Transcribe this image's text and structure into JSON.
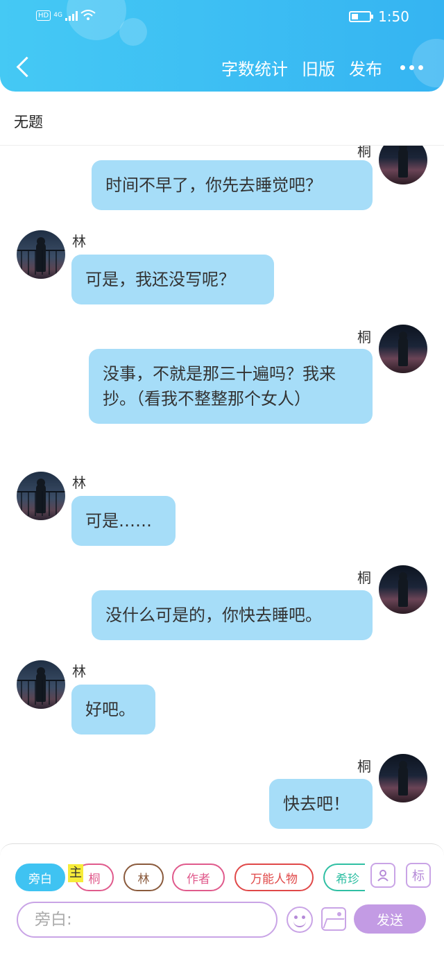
{
  "status_bar": {
    "network": "HD",
    "signal_label": "4G",
    "time": "1:50"
  },
  "header": {
    "actions": [
      "字数统计",
      "旧版",
      "发布"
    ]
  },
  "title": "无题",
  "messages": [
    {
      "side": "right",
      "name": "桐",
      "text": "时间不早了，你先去睡觉吧？"
    },
    {
      "side": "left",
      "name": "林",
      "text": "可是，我还没写呢？"
    },
    {
      "side": "right",
      "name": "桐",
      "text": "没事，不就是那三十遍吗？我来抄。（看我不整整那个女人）"
    },
    {
      "side": "left",
      "name": "林",
      "text": "可是……"
    },
    {
      "side": "right",
      "name": "桐",
      "text": "没什么可是的，你快去睡吧。"
    },
    {
      "side": "left",
      "name": "林",
      "text": "好吧。"
    },
    {
      "side": "right",
      "name": "桐",
      "text": "快去吧！"
    }
  ],
  "toolbar": {
    "roles": [
      "旁白",
      "桐",
      "林",
      "作者",
      "万能人物",
      "希珍"
    ],
    "active_role": "旁白",
    "main_tag": "主",
    "role_icon_label": "标",
    "input_placeholder": "旁白:",
    "send_label": "发送"
  },
  "icons": [
    "back-icon",
    "more-icon",
    "wifi-icon",
    "battery-icon",
    "add-role-icon",
    "emoji-icon",
    "image-icon"
  ]
}
